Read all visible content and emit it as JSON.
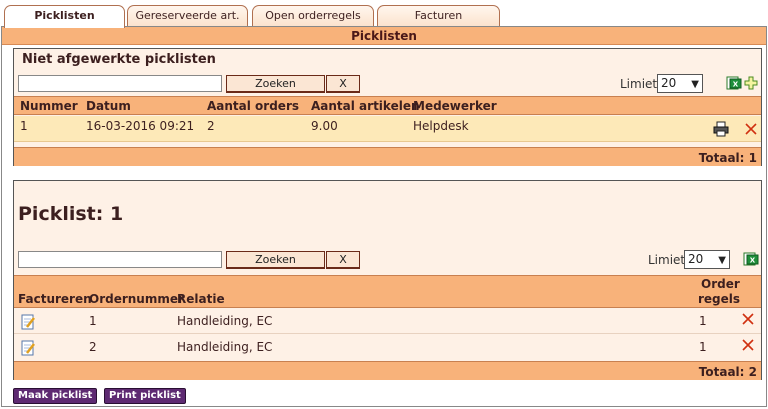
{
  "tabs": [
    {
      "label": "Picklisten"
    },
    {
      "label": "Gereserveerde art."
    },
    {
      "label": "Open orderregels"
    },
    {
      "label": "Facturen"
    }
  ],
  "header": {
    "title": "Picklisten"
  },
  "section1": {
    "title": "Niet afgewerkte picklisten",
    "search": {
      "value": "",
      "button": "Zoeken",
      "clear": "X"
    },
    "limit": {
      "label": "Limiet",
      "value": "20"
    },
    "columns": [
      "Nummer",
      "Datum",
      "Aantal orders",
      "Aantal artikelen",
      "Medewerker"
    ],
    "rows": [
      {
        "nummer": "1",
        "datum": "16-03-2016 09:21",
        "orders": "2",
        "artikelen": "9.00",
        "medewerker": "Helpdesk"
      }
    ],
    "total": "Totaal: 1"
  },
  "section2": {
    "title": "Picklist: 1",
    "search": {
      "value": "",
      "button": "Zoeken",
      "clear": "X"
    },
    "limit": {
      "label": "Limiet",
      "value": "20"
    },
    "columns": [
      "Factureren",
      "Ordernummer",
      "Relatie",
      "Order",
      "regels"
    ],
    "rows": [
      {
        "ordernummer": "1",
        "relatie": "Handleiding, EC",
        "regels": "1"
      },
      {
        "ordernummer": "2",
        "relatie": "Handleiding, EC",
        "regels": "1"
      }
    ],
    "total": "Totaal: 2"
  },
  "actions": {
    "make": "Maak picklist",
    "print": "Print picklist"
  },
  "colors": {
    "accent": "#f8b27a",
    "panel": "#fef1e6",
    "highlight": "#fde9b8",
    "button": "#5e2a72",
    "delete": "#d03010"
  }
}
